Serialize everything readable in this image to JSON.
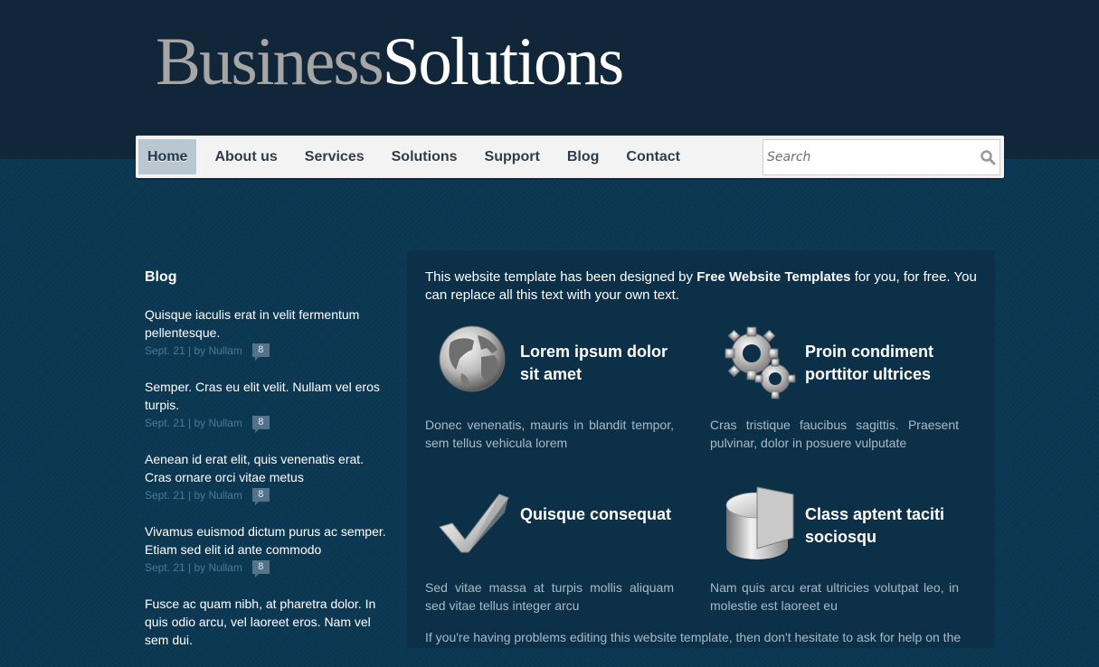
{
  "brand": {
    "part1": "Business",
    "part2": "Solutions"
  },
  "nav": {
    "items": [
      {
        "label": "Home",
        "active": true
      },
      {
        "label": "About us"
      },
      {
        "label": "Services"
      },
      {
        "label": "Solutions"
      },
      {
        "label": "Support"
      },
      {
        "label": "Blog"
      },
      {
        "label": "Contact"
      }
    ]
  },
  "search": {
    "placeholder": "Search",
    "icon": "magnifier-icon"
  },
  "sidebar": {
    "title": "Blog",
    "posts": [
      {
        "text": "Quisque iaculis erat in velit fermentum pellentesque.",
        "meta": "Sept. 21 | by Nullam",
        "comments": "8"
      },
      {
        "text": "Semper. Cras eu elit velit. Nullam vel eros turpis.",
        "meta": "Sept. 21 | by Nullam",
        "comments": "8"
      },
      {
        "text": "Aenean id erat elit, quis venenatis erat. Cras ornare orci vitae metus",
        "meta": "Sept. 21 | by Nullam",
        "comments": "8"
      },
      {
        "text": "Vivamus euismod dictum purus ac semper. Etiam sed elit id ante commodo",
        "meta": "Sept. 21 | by Nullam",
        "comments": "8"
      },
      {
        "text": "Fusce ac quam nibh, at pharetra dolor. In quis odio arcu, vel laoreet eros. Nam vel sem dui."
      }
    ]
  },
  "main": {
    "intro": {
      "before": "This website template has been designed by ",
      "link": "Free Website Templates",
      "after": " for you, for free. You can replace all this text with your own text."
    },
    "features": [
      {
        "icon": "globe-icon",
        "title": "Lorem ipsum dolor sit amet",
        "text": "Donec venenatis, mauris in blandit tempor, sem tellus vehicula lorem"
      },
      {
        "icon": "gears-icon",
        "title": "Proin condiment porttitor ultrices",
        "text": "Cras tristique faucibus sagittis. Praesent pulvinar, dolor in posuere vulputate"
      },
      {
        "icon": "checkmark-icon",
        "title": "Quisque consequat",
        "text": "Sed vitae massa at turpis mollis aliquam sed vitae tellus integer arcu"
      },
      {
        "icon": "pie-chart-icon",
        "title": "Class aptent taciti sociosqu",
        "text": "Nam quis arcu erat ultricies volutpat leo, in molestie est laoreet eu"
      }
    ],
    "outro": "If you're having problems editing this website template, then don't hesitate to ask for help on the"
  },
  "colors": {
    "header_bg": "#12263a",
    "body_bg": "#0c3a55",
    "content_bg": "#0b3048",
    "nav_active": "#b9c7d1",
    "meta_text": "#4d7896"
  }
}
